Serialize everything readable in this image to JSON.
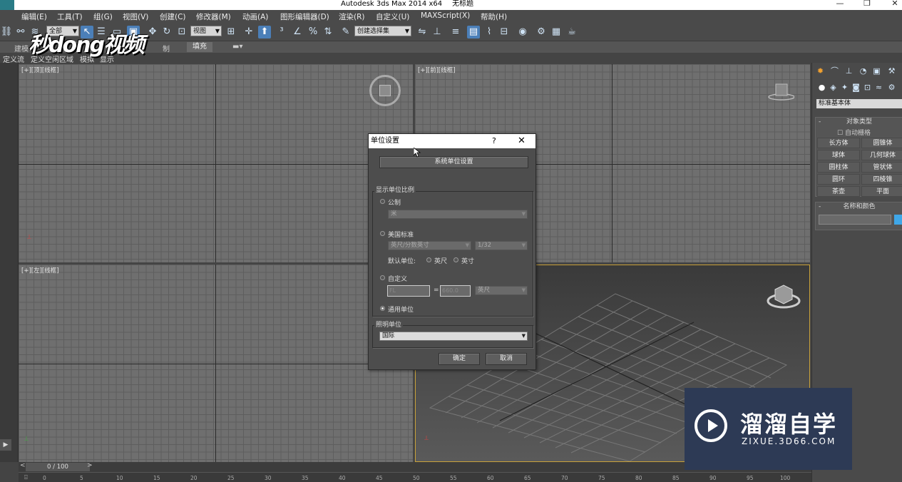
{
  "window": {
    "title": "Autodesk 3ds Max  2014 x64",
    "document": "无标题",
    "minimize": "—",
    "maximize": "❐",
    "close": "✕"
  },
  "menu": [
    "编辑(E)",
    "工具(T)",
    "组(G)",
    "视图(V)",
    "创建(C)",
    "修改器(M)",
    "动画(A)",
    "图形编辑器(D)",
    "渲染(R)",
    "自定义(U)",
    "MAXScript(X)",
    "帮助(H)"
  ],
  "toolbar": {
    "selection_filter": "全部",
    "ref_coord": "视图",
    "named_selection": "创建选择集"
  },
  "ribbon": {
    "tabs": [
      "建模",
      "制",
      "填充"
    ]
  },
  "subribbon": [
    "定义流",
    "定义空闲区域",
    "模拟",
    "显示"
  ],
  "logo": "秒dong视频",
  "viewports": {
    "top": "[+][顶][线框]",
    "front": "[+][前][线框]",
    "left": "[+][左][线框]"
  },
  "command_panel": {
    "category": "标准基本体",
    "object_type": {
      "header": "对象类型",
      "autogrid": "自动栅格",
      "buttons": [
        "长方体",
        "圆锥体",
        "球体",
        "几何球体",
        "圆柱体",
        "管状体",
        "圆环",
        "四棱锥",
        "茶壶",
        "平面"
      ]
    },
    "name_color": {
      "header": "名称和颜色",
      "name_value": ""
    }
  },
  "timeline": {
    "slider": "0 / 100",
    "ticks": [
      "0",
      "5",
      "10",
      "15",
      "20",
      "25",
      "30",
      "35",
      "40",
      "45",
      "50",
      "55",
      "60",
      "65",
      "70",
      "75",
      "80",
      "85",
      "90",
      "95",
      "100"
    ]
  },
  "dialog": {
    "title": "单位设置",
    "help": "?",
    "close": "✕",
    "system_button": "系统单位设置",
    "display_group": "显示单位比例",
    "metric": {
      "label": "公制",
      "value": "米"
    },
    "us": {
      "label": "美国标准",
      "unit": "英尺/分数英寸",
      "fraction": "1/32",
      "default_label": "默认单位:",
      "feet": "英尺",
      "inches": "英寸"
    },
    "custom": {
      "label": "自定义",
      "name": "FL",
      "equals": "=",
      "value": "660.0",
      "unit": "英尺"
    },
    "generic": {
      "label": "通用单位"
    },
    "lighting_group": "照明单位",
    "lighting_value": "国际",
    "ok": "确定",
    "cancel": "取消"
  },
  "watermark": {
    "title": "溜溜自学",
    "url": "ZIXUE.3D66.COM"
  },
  "colors": {
    "accent": "#4b7fb8",
    "viewport_highlight": "#c9a23a",
    "watermark_bg": "#2d3a55"
  }
}
